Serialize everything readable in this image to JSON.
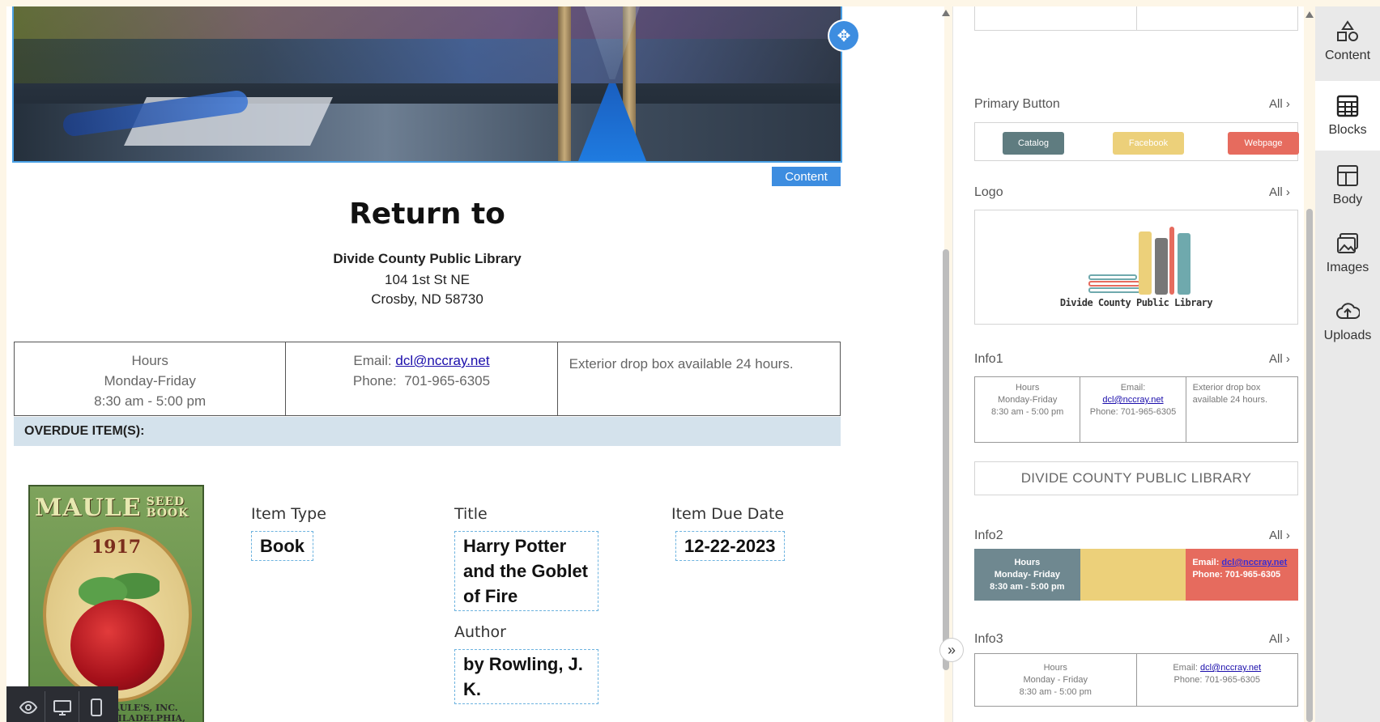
{
  "canvas": {
    "content_tag": "Content",
    "return_title": "Return to",
    "library": {
      "name": "Divide County Public Library",
      "street": "104 1st St NE",
      "city": "Crosby, ND 58730"
    },
    "info": {
      "hours_label": "Hours",
      "days": "Monday-Friday",
      "time": "8:30 am - 5:00 pm",
      "email_label": "Email:",
      "email": "dcl@nccray.net",
      "phone_label": "Phone:",
      "phone": "701-965-6305",
      "dropbox": "Exterior drop box available 24 hours."
    },
    "overdue_header": "OVERDUE ITEM(S):",
    "cover": {
      "brand": "MAULE",
      "brand_small_1": "SEED",
      "brand_small_2": "BOOK",
      "year": "1917",
      "publisher_1": "MAULE'S, INC.",
      "publisher_2": "PHILADELPHIA, PENNA."
    },
    "item": {
      "type_label": "Item Type",
      "type_value": "Book",
      "title_label": "Title",
      "title_value": "Harry Potter and the Goblet of Fire",
      "author_label": "Author",
      "author_value": "by Rowling, J. K.",
      "due_label": "Item Due Date",
      "due_value": "12-22-2023"
    }
  },
  "panel": {
    "sections": [
      {
        "title": "Primary Button",
        "all": "All"
      },
      {
        "title": "Logo",
        "all": "All"
      },
      {
        "title": "Info1",
        "all": "All"
      },
      {
        "title": "Info2",
        "all": "All"
      },
      {
        "title": "Info3",
        "all": "All"
      }
    ],
    "primary_buttons": [
      {
        "label": "Catalog",
        "color": "#5f7c80"
      },
      {
        "label": "Facebook",
        "color": "#ecd07a"
      },
      {
        "label": "Webpage",
        "color": "#e66b5e"
      }
    ],
    "logo_text": "Divide County Public Library",
    "banner_text": "DIVIDE COUNTY PUBLIC LIBRARY",
    "info2": {
      "hours": "Hours",
      "days": "Monday- Friday",
      "time": "8:30 am - 5:00 pm",
      "email_label": "Email:",
      "email": "dcl@nccray.net",
      "phone": "Phone: 701-965-6305",
      "colors": [
        "#6f8890",
        "#ecd07a",
        "#e66b5e"
      ]
    },
    "info3": {
      "hours": "Hours",
      "days": "Monday - Friday",
      "time": "8:30 am - 5:00 pm",
      "email_label": "Email:",
      "email": "dcl@nccray.net",
      "phone": "Phone: 701-965-6305"
    },
    "info1_mini": {
      "hours": "Hours",
      "days": "Monday-Friday",
      "time": "8:30 am - 5:00 pm",
      "email_label": "Email:",
      "email": "dcl@nccray.net",
      "phone": "Phone: 701-965-6305",
      "dropbox": "Exterior drop box available 24 hours."
    }
  },
  "tabs": [
    {
      "label": "Content",
      "icon": "shapes-icon"
    },
    {
      "label": "Blocks",
      "icon": "blocks-icon"
    },
    {
      "label": "Body",
      "icon": "layout-icon"
    },
    {
      "label": "Images",
      "icon": "images-icon"
    },
    {
      "label": "Uploads",
      "icon": "cloud-upload-icon"
    }
  ],
  "colors": {
    "accent": "#3d8de0",
    "overdue_bar": "#d4e2ec"
  }
}
